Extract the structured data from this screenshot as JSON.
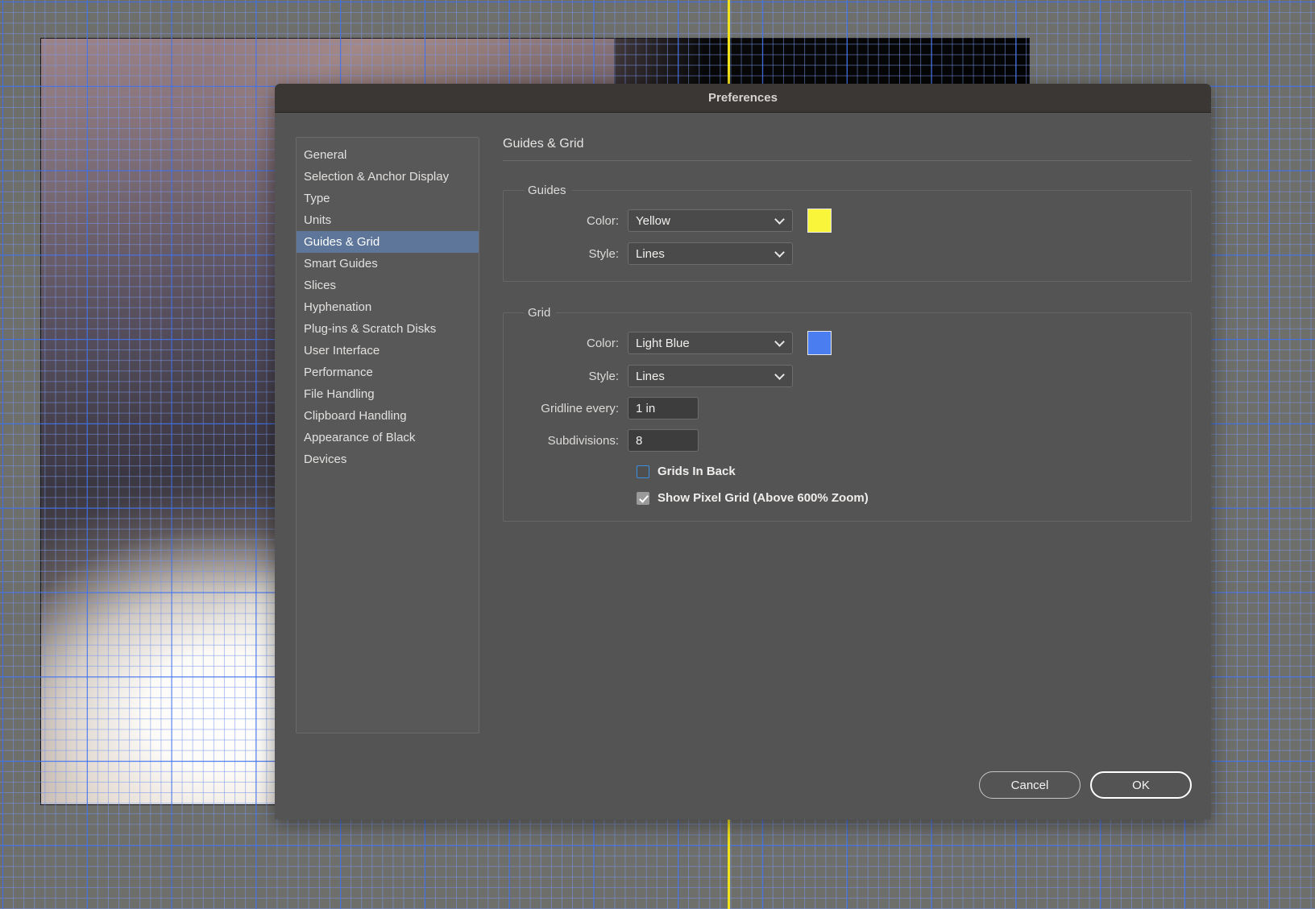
{
  "background": {
    "guide_color": "#f2e21a",
    "grid_color": "#3a6ef0",
    "canvas_color": "#6e6e6b"
  },
  "dialog": {
    "title": "Preferences"
  },
  "sidebar": {
    "items": [
      {
        "label": "General",
        "selected": false
      },
      {
        "label": "Selection & Anchor Display",
        "selected": false
      },
      {
        "label": "Type",
        "selected": false
      },
      {
        "label": "Units",
        "selected": false
      },
      {
        "label": "Guides & Grid",
        "selected": true
      },
      {
        "label": "Smart Guides",
        "selected": false
      },
      {
        "label": "Slices",
        "selected": false
      },
      {
        "label": "Hyphenation",
        "selected": false
      },
      {
        "label": "Plug-ins & Scratch Disks",
        "selected": false
      },
      {
        "label": "User Interface",
        "selected": false
      },
      {
        "label": "Performance",
        "selected": false
      },
      {
        "label": "File Handling",
        "selected": false
      },
      {
        "label": "Clipboard Handling",
        "selected": false
      },
      {
        "label": "Appearance of Black",
        "selected": false
      },
      {
        "label": "Devices",
        "selected": false
      }
    ]
  },
  "pane": {
    "heading": "Guides & Grid",
    "guides": {
      "legend": "Guides",
      "color_label": "Color:",
      "color_value": "Yellow",
      "color_swatch": "#f9f53a",
      "style_label": "Style:",
      "style_value": "Lines"
    },
    "grid": {
      "legend": "Grid",
      "color_label": "Color:",
      "color_value": "Light Blue",
      "color_swatch": "#4a7ef0",
      "style_label": "Style:",
      "style_value": "Lines",
      "gridline_label": "Gridline every:",
      "gridline_value": "1 in",
      "subdivisions_label": "Subdivisions:",
      "subdivisions_value": "8",
      "grids_in_back_label": "Grids In Back",
      "grids_in_back_checked": false,
      "pixel_grid_label": "Show Pixel Grid (Above 600% Zoom)",
      "pixel_grid_checked": true
    }
  },
  "footer": {
    "cancel_label": "Cancel",
    "ok_label": "OK"
  }
}
